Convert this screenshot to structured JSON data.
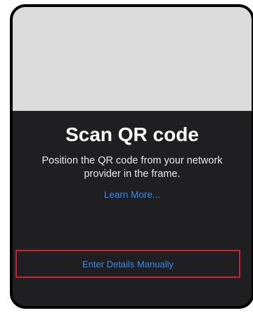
{
  "scan": {
    "title": "Scan QR code",
    "description": "Position the QR code from your network provider in the frame.",
    "learn_more": "Learn More...",
    "manual_label": "Enter Details Manually"
  },
  "colors": {
    "background": "#1f1f21",
    "camera_preview": "#dcdcdc",
    "link": "#2f8bf0",
    "highlight": "#c62334"
  }
}
